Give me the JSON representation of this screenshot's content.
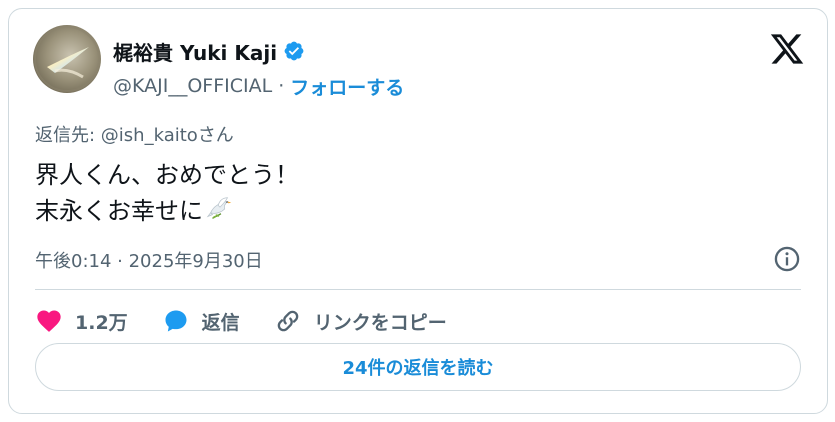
{
  "author": {
    "name": "梶裕貴 Yuki Kaji",
    "handle": "@KAJI__OFFICIAL",
    "separator": "·",
    "follow_label": "フォローする",
    "verified_color": "#1d9bf0"
  },
  "tweet": {
    "reply_prefix": "返信先: ",
    "reply_mention": "@ish_kaito",
    "reply_suffix": "さん",
    "lines": [
      "界人くん、おめでとう！",
      "末永くお幸せに"
    ],
    "emoji_icon": "dove-icon",
    "timestamp": "午後0:14 · 2025年9月30日"
  },
  "actions": {
    "likes": "1.2万",
    "reply_label": "返信",
    "copy_link_label": "リンクをコピー"
  },
  "read_replies_label": "24件の返信を読む",
  "colors": {
    "accent": "#1a8cd8",
    "like": "#f91880",
    "reply": "#1d9bf0",
    "muted": "#536471"
  }
}
